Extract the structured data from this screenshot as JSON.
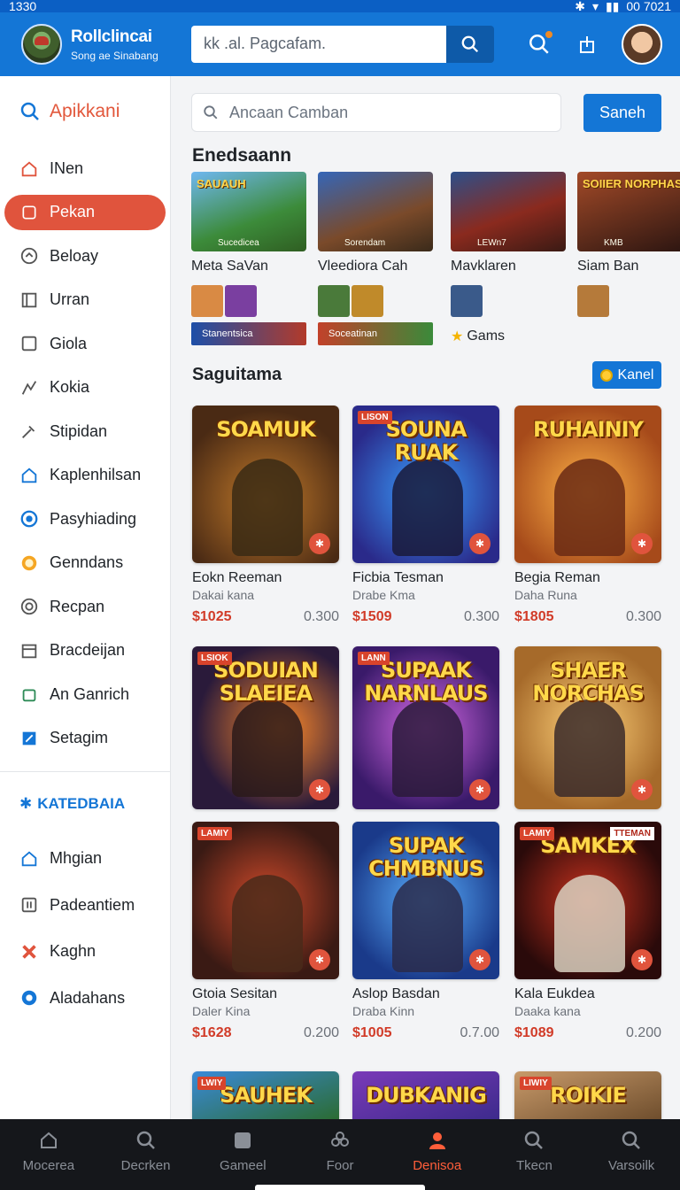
{
  "status": {
    "time": "1330",
    "right_text": "00 7021"
  },
  "header": {
    "app_name": "Rollclincai",
    "tagline": "Song ae Sinabang",
    "search_value": "kk .al. Pagcafam."
  },
  "sidebar": {
    "title": "Apikkani",
    "items": [
      {
        "label": "INen",
        "icon": "home-icon"
      },
      {
        "label": "Pekan",
        "icon": "square-icon",
        "active": true
      },
      {
        "label": "Beloay",
        "icon": "gauge-icon"
      },
      {
        "label": "Urran",
        "icon": "frame-icon"
      },
      {
        "label": "Giola",
        "icon": "box-icon"
      },
      {
        "label": "Kokia",
        "icon": "chart-icon"
      },
      {
        "label": "Stipidan",
        "icon": "wrench-icon"
      },
      {
        "label": "Kaplenhilsan",
        "icon": "house-icon"
      },
      {
        "label": "Pasyhiading",
        "icon": "target-icon"
      },
      {
        "label": "Genndans",
        "icon": "coin-icon"
      },
      {
        "label": "Recpan",
        "icon": "record-icon"
      },
      {
        "label": "Bracdeijan",
        "icon": "calendar-icon"
      },
      {
        "label": "An Ganrich",
        "icon": "bag-icon"
      },
      {
        "label": "Setagim",
        "icon": "edit-icon"
      }
    ],
    "category_title": "KATEDBAIA",
    "category_items": [
      {
        "label": "Mhgian",
        "icon": "house-icon"
      },
      {
        "label": "Padeantiem",
        "icon": "pause-icon"
      },
      {
        "label": "Kaghn",
        "icon": "cross-icon"
      },
      {
        "label": "Aladahans",
        "icon": "shield-icon"
      }
    ]
  },
  "main": {
    "search_placeholder": "Ancaan Camban",
    "search_button": "Saneh",
    "section1_title": "Enedsaann",
    "featured": [
      {
        "name": "Meta SaVan",
        "art_text": "SAUAUH",
        "art_sub": "Sucedicea",
        "pill": "Stanentsica"
      },
      {
        "name": "Vleediora Cah",
        "art_text": "",
        "art_sub": "Sorendam",
        "pill": "Soceatinan"
      },
      {
        "name": "Mavklaren",
        "art_text": "",
        "art_sub": "LEWn7",
        "gams": "Gams"
      },
      {
        "name": "Siam Ban",
        "art_text": "SOIIER NORPHAS",
        "art_sub": "KMB"
      }
    ],
    "section2_title": "Saguitama",
    "kanel_button": "Kanel",
    "cards": [
      {
        "art_text": "SOAMUK",
        "title": "Eokn Reeman",
        "sub": "Dakai kana",
        "price": "$1025",
        "rating": "0.300",
        "badge": ""
      },
      {
        "art_text": "SOUNA RUAK",
        "title": "Ficbia Tesman",
        "sub": "Drabe Kma",
        "price": "$1509",
        "rating": "0.300",
        "badge": "LISON"
      },
      {
        "art_text": "RUHAINIY",
        "title": "Begia Reman",
        "sub": "Daha Runa",
        "price": "$1805",
        "rating": "0.300",
        "badge": ""
      },
      {
        "art_text": "SODUIAN SLAEIEA",
        "title": "",
        "sub": "",
        "price": "",
        "rating": "",
        "badge": "LSIOK"
      },
      {
        "art_text": "SUPAAK NARNLAUS",
        "title": "",
        "sub": "",
        "price": "",
        "rating": "",
        "badge": "LANN"
      },
      {
        "art_text": "SHAER NORCHAS",
        "title": "",
        "sub": "",
        "price": "",
        "rating": "",
        "badge": ""
      },
      {
        "art_text": "",
        "title": "Gtoia Sesitan",
        "sub": "Daler Kina",
        "price": "$1628",
        "rating": "0.200",
        "badge": "LAMIY"
      },
      {
        "art_text": "SUPAK CHMBNUS",
        "title": "Aslop Basdan",
        "sub": "Draba Kinn",
        "price": "$1005",
        "rating": "0.7.00",
        "badge": ""
      },
      {
        "art_text": "SAMKEX",
        "title": "Kala Eukdea",
        "sub": "Daaka kana",
        "price": "$1089",
        "rating": "0.200",
        "badge": "LAMIY",
        "badge_r": "TTEMAN"
      },
      {
        "art_text": "SAUHEK",
        "badge": "LWIY"
      },
      {
        "art_text": "DUBKANIG",
        "badge": ""
      },
      {
        "art_text": "ROIKIE",
        "badge": "LIWIY"
      }
    ]
  },
  "bottom_nav": [
    {
      "label": "Mocerea",
      "icon": "home-icon"
    },
    {
      "label": "Decrken",
      "icon": "search-icon"
    },
    {
      "label": "Gameel",
      "icon": "gamepad-icon"
    },
    {
      "label": "Foor",
      "icon": "flower-icon"
    },
    {
      "label": "Denisoa",
      "icon": "profile-icon",
      "active": true
    },
    {
      "label": "Tkecn",
      "icon": "search-icon"
    },
    {
      "label": "Varsoilk",
      "icon": "search-icon"
    }
  ],
  "colors": {
    "primary": "#1476d6",
    "accent": "#e0543d",
    "price": "#d13b28"
  }
}
